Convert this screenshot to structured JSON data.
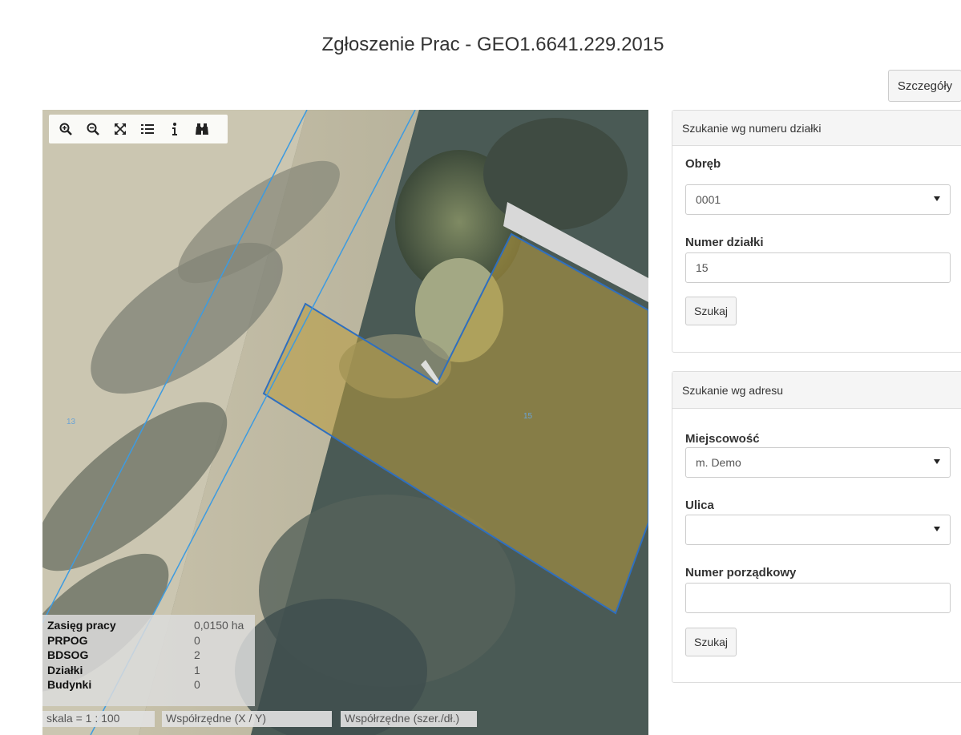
{
  "header": {
    "title": "Zgłoszenie Prac - GEO1.6641.229.2015",
    "details_button": "Szczegóły"
  },
  "map": {
    "toolbar": [
      {
        "name": "zoom-in-icon"
      },
      {
        "name": "zoom-out-icon"
      },
      {
        "name": "full-extent-icon"
      },
      {
        "name": "layers-list-icon"
      },
      {
        "name": "info-icon"
      },
      {
        "name": "binoculars-icon"
      }
    ],
    "parcel_labels": {
      "left": "13",
      "right": "15"
    },
    "stats": [
      {
        "label": "Zasięg pracy",
        "value": "0,0150 ha"
      },
      {
        "label": "PRPOG",
        "value": "0"
      },
      {
        "label": "BDSOG",
        "value": "2"
      },
      {
        "label": "Działki",
        "value": "1"
      },
      {
        "label": "Budynki",
        "value": "0"
      }
    ],
    "status": {
      "scale": "skala = 1 : 100",
      "coords_xy": "Współrzędne (X / Y)",
      "coords_latlon": "Współrzędne (szer./dł.)"
    },
    "colors": {
      "parcel_outline": "#2f6fbf",
      "parcel_fill": "#b89a3c",
      "boundary_line": "#3d9be0"
    }
  },
  "parcel_search": {
    "heading": "Szukanie wg numeru działki",
    "precinct_label": "Obręb",
    "precinct_value": "0001",
    "parcel_number_label": "Numer działki",
    "parcel_number_value": "15",
    "search_button": "Szukaj"
  },
  "address_search": {
    "heading": "Szukanie wg adresu",
    "locality_label": "Miejscowość",
    "locality_value": "m. Demo",
    "street_label": "Ulica",
    "street_value": "",
    "house_number_label": "Numer porządkowy",
    "house_number_value": "",
    "search_button": "Szukaj"
  }
}
